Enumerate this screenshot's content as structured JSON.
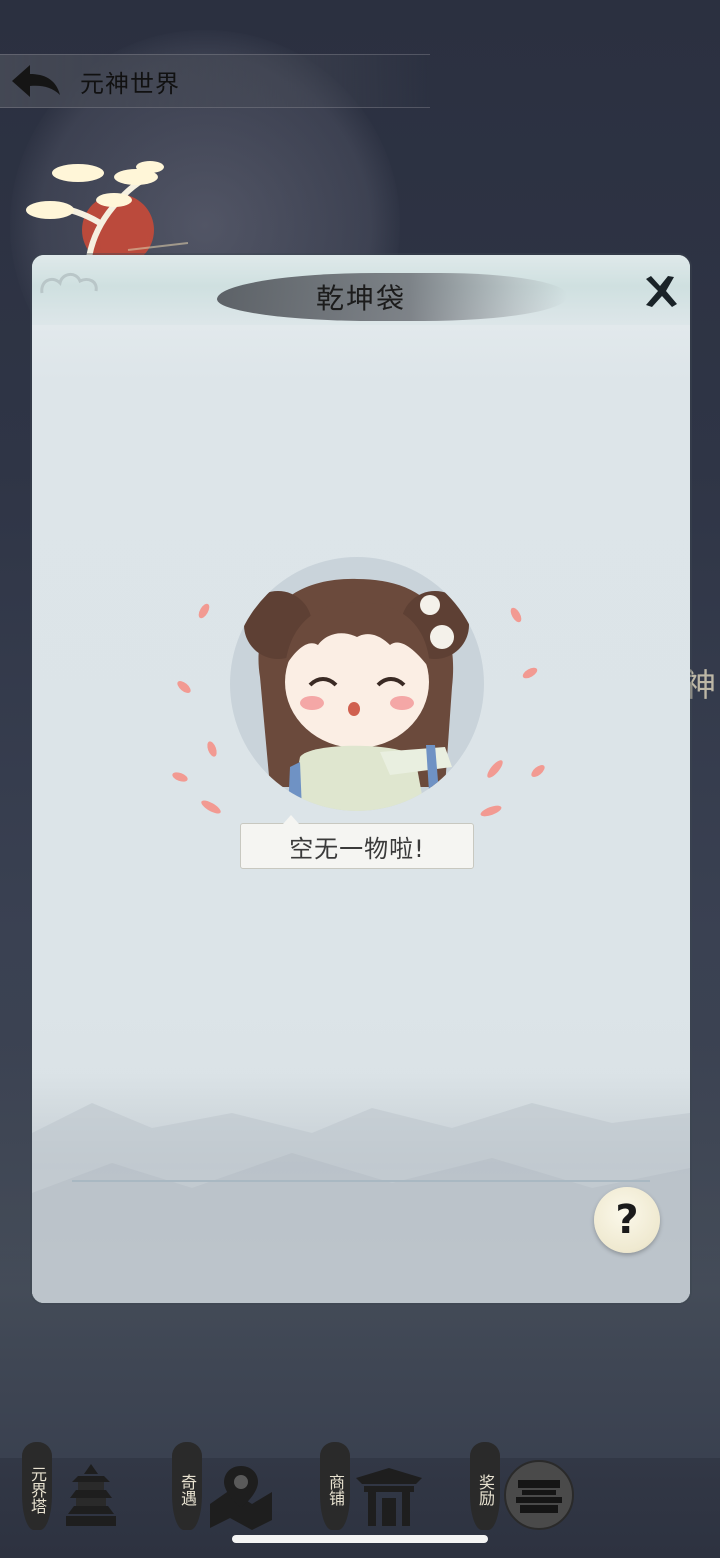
{
  "header": {
    "back_icon": "back-arrow-icon",
    "title": "元神世界"
  },
  "side_partial_text": "神",
  "panel": {
    "title": "乾坤袋",
    "close_icon": "close-icon",
    "empty_message": "空无一物啦!",
    "help_label": "?"
  },
  "bottom_nav": [
    {
      "label": "元界塔",
      "icon": "pagoda-icon"
    },
    {
      "label": "奇遇",
      "icon": "map-location-icon"
    },
    {
      "label": "商铺",
      "icon": "shop-gate-icon"
    },
    {
      "label": "奖励",
      "icon": "treasure-chest-icon"
    }
  ],
  "colors": {
    "background": "#2f3546",
    "panel": "#dce4e8",
    "petal": "#f29a92",
    "title_brush": "#6e7278"
  }
}
